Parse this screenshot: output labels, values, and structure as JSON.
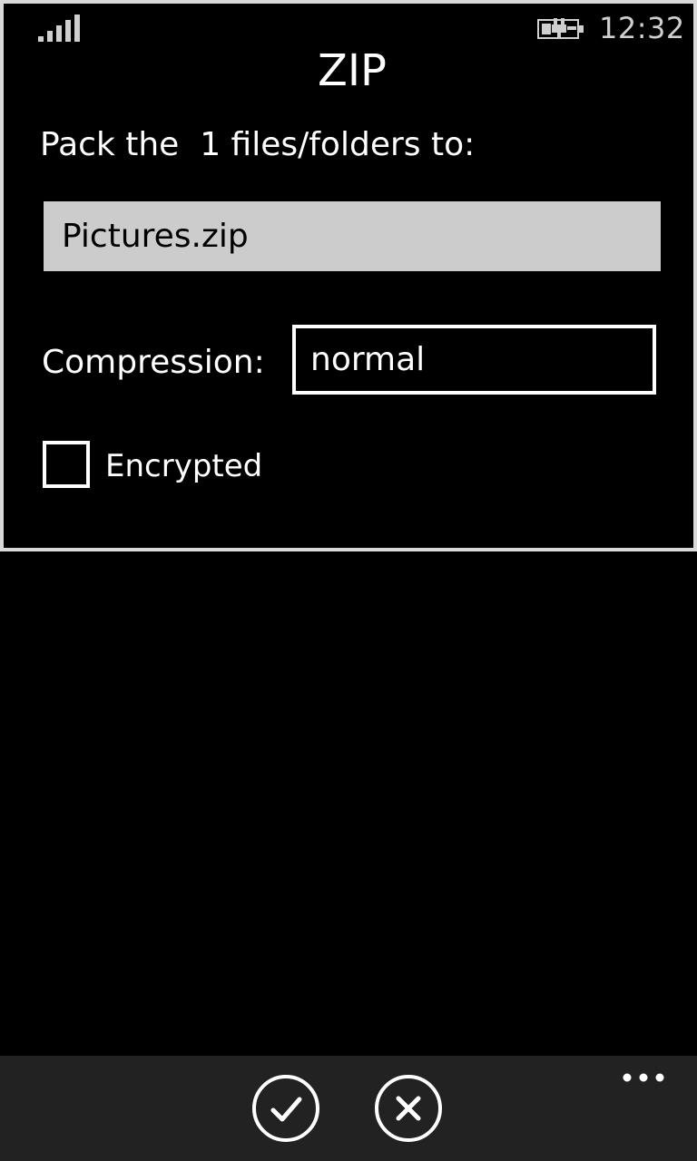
{
  "status_bar": {
    "time": "12:32",
    "signal_icon": "signal-strength-icon",
    "battery_icon": "battery-charging-icon"
  },
  "dialog": {
    "title": "ZIP",
    "subtitle": "Pack the  1 files/folders to:",
    "filename_value": "Pictures.zip",
    "compression_label": "Compression:",
    "compression_value": "normal",
    "encrypted_label": "Encrypted",
    "encrypted_checked": false
  },
  "app_bar": {
    "ok_icon": "check-icon",
    "cancel_icon": "close-icon",
    "more_icon": "ellipsis-icon"
  },
  "colors": {
    "background": "#000000",
    "field_background": "#cccccc",
    "app_bar": "#222222",
    "dialog_border": "#d9d9d9"
  }
}
